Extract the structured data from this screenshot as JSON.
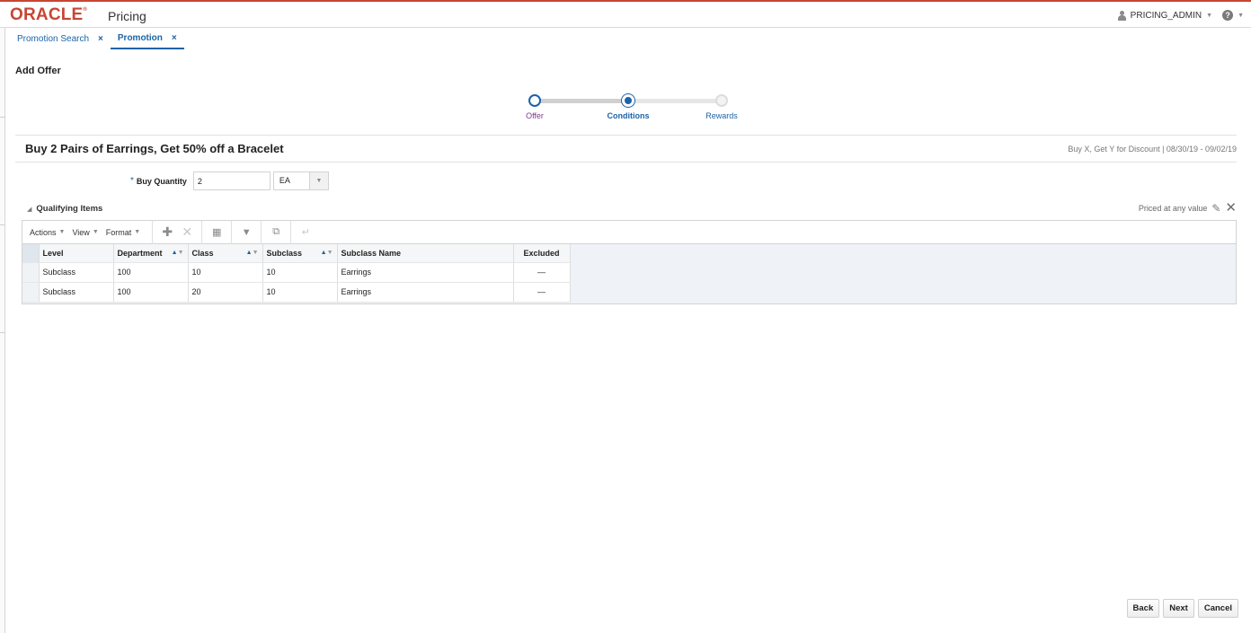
{
  "app": {
    "brand": "ORACLE",
    "name": "Pricing"
  },
  "user": {
    "name": "PRICING_ADMIN",
    "help_glyph": "?"
  },
  "tabs": [
    {
      "label": "Promotion Search",
      "close": "×"
    },
    {
      "label": "Promotion",
      "close": "×"
    }
  ],
  "page": {
    "title": "Add Offer"
  },
  "train": {
    "stops": [
      {
        "label": "Offer"
      },
      {
        "label": "Conditions"
      },
      {
        "label": "Rewards"
      }
    ]
  },
  "offer": {
    "title": "Buy 2 Pairs of Earrings, Get 50% off a Bracelet",
    "meta": "Buy X, Get Y for Discount | 08/30/19 - 09/02/19"
  },
  "buy_quantity": {
    "required_mark": "*",
    "label": "Buy Quantity",
    "value": "2",
    "uom": "EA"
  },
  "qualifying": {
    "title": "Qualifying Items",
    "priced_label": "Priced at any value",
    "toolbar": {
      "actions": "Actions",
      "view": "View",
      "format": "Format"
    },
    "columns": [
      "Level",
      "Department",
      "Class",
      "Subclass",
      "Subclass Name",
      "Excluded"
    ],
    "rows": [
      {
        "level": "Subclass",
        "department": "100",
        "class": "10",
        "subclass": "10",
        "subclass_name": "Earrings",
        "excluded": "—"
      },
      {
        "level": "Subclass",
        "department": "100",
        "class": "20",
        "subclass": "10",
        "subclass_name": "Earrings",
        "excluded": "—"
      }
    ]
  },
  "buttons": {
    "back": "Back",
    "next": "Next",
    "cancel": "Cancel"
  },
  "colors": {
    "brand": "#c74634",
    "accent": "#1c63a8",
    "offer_label": "#7e3a8e"
  }
}
